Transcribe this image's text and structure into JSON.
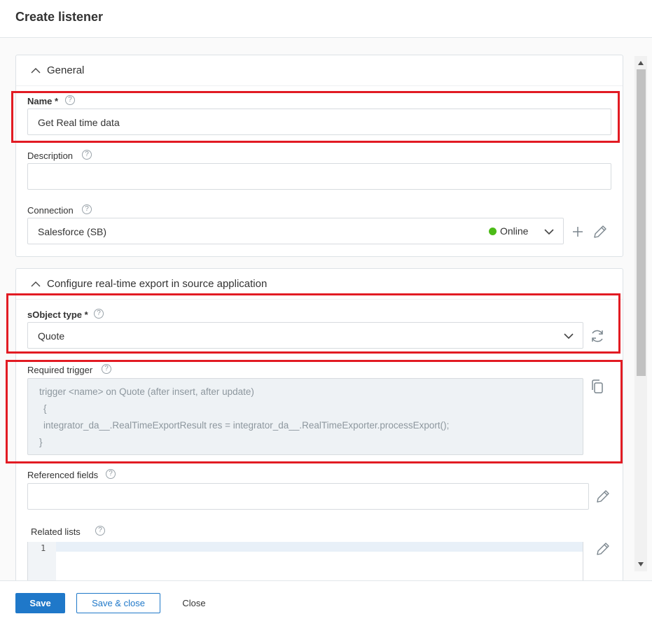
{
  "window": {
    "title": "Create listener"
  },
  "general": {
    "section_title": "General",
    "name_label": "Name *",
    "name_value": "Get Real time data",
    "description_label": "Description",
    "description_value": "",
    "connection_label": "Connection",
    "connection_value": "Salesforce (SB)",
    "connection_status": "Online"
  },
  "config": {
    "section_title": "Configure real-time export in source application",
    "sobject_label": "sObject type *",
    "sobject_value": "Quote",
    "trigger_label": "Required trigger",
    "trigger_lines": [
      "trigger <name> on Quote (after insert, after update)",
      "{",
      "integrator_da__.RealTimeExportResult res = integrator_da__.RealTimeExporter.processExport();",
      "}"
    ],
    "referenced_fields_label": "Referenced fields",
    "referenced_fields_value": "",
    "related_lists_label": "Related lists",
    "related_lists_line_number": "1"
  },
  "help_glyph": "?",
  "footer": {
    "save_label": "Save",
    "save_close_label": "Save & close",
    "close_label": "Close"
  },
  "colors": {
    "primary": "#1f78c9",
    "highlight": "#e21b23",
    "online": "#4cbb17"
  }
}
